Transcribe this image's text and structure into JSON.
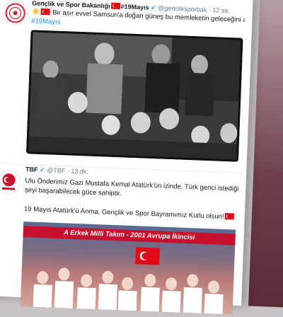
{
  "tweets": [
    {
      "account_name": "Gençlik ve Spor Bakanlığı",
      "account_hashtag": "#19Mayıs",
      "handle": "@gencliksporbak",
      "time": "12 sa.",
      "text": "Bir asır evvel Samsun'a doğan güneş bu memleketin geleceğini aydınlattı...",
      "hashtag": "#19Mayıs"
    },
    {
      "account_name": "TBF",
      "handle": "@TBF",
      "time": "13 dk.",
      "text_line1": "Ulu Önderimiz Gazi Mustafa Kemal Atatürk'ün izinde, Türk genci istediğinde her",
      "text_line2": "şeyi başarabilecek güce sahiptir.",
      "text_line3": "19 Mayıs Atatürk'ü Anma, Gençlik ve Spor Bayramımız Kutlu olsun!",
      "banner": "A Erkek Milli Takım - 2001 Avrupa İkincisi"
    }
  ],
  "colors": {
    "link": "#1b95e0",
    "flag_red": "#e30a17",
    "banner_red": "#c8102e"
  }
}
